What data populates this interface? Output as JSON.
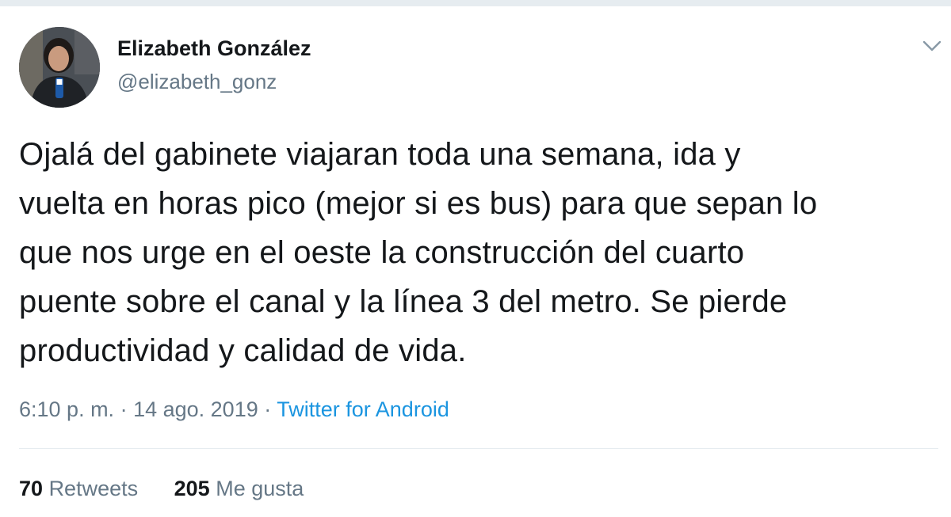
{
  "tweet": {
    "author": {
      "name": "Elizabeth González",
      "handle": "@elizabeth_gonz"
    },
    "text_lines": [
      "Ojalá del gabinete viajaran toda una semana, ida y",
      "vuelta en horas pico (mejor si es bus) para que sepan lo",
      "que nos urge en el oeste la construcción del cuarto",
      "puente sobre el canal y la línea 3 del metro. Se pierde",
      "productividad y calidad de vida."
    ],
    "meta": {
      "time": "6:10 p. m.",
      "separator": " · ",
      "date": "14 ago. 2019",
      "source": "Twitter for Android"
    },
    "stats": {
      "retweets_count": "70",
      "retweets_label": "Retweets",
      "likes_count": "205",
      "likes_label": "Me gusta"
    },
    "icons": {
      "menu": "chevron-down-icon"
    }
  },
  "colors": {
    "primary_text": "#14171a",
    "secondary_text": "#657786",
    "link": "#1b95e0",
    "divider": "#e6ecf0"
  }
}
